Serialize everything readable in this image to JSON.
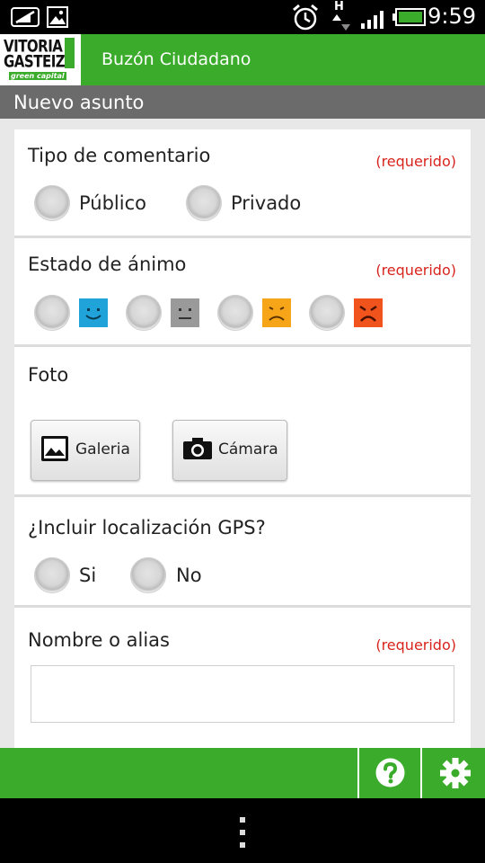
{
  "status_bar": {
    "time": "9:59",
    "network_label": "H"
  },
  "app_bar": {
    "logo_line1": "VITORIA",
    "logo_line2": "GASTEIZ",
    "logo_line3": "green capital",
    "title": "Buzón Ciudadano",
    "accent_color": "#3aab2a"
  },
  "section": {
    "title": "Nuevo asunto"
  },
  "form": {
    "comment_type": {
      "label": "Tipo de comentario",
      "required": "(requerido)",
      "options": [
        "Público",
        "Privado"
      ]
    },
    "mood": {
      "label": "Estado de ánimo",
      "required": "(requerido)",
      "options": [
        {
          "icon": "happy-face-icon",
          "color": "#1fa3d8"
        },
        {
          "icon": "neutral-face-icon",
          "color": "#9a9a9a"
        },
        {
          "icon": "sad-face-icon",
          "color": "#f6a418"
        },
        {
          "icon": "angry-face-icon",
          "color": "#f0541c"
        }
      ]
    },
    "photo": {
      "label": "Foto",
      "gallery_button": "Galeria",
      "camera_button": "Cámara"
    },
    "gps": {
      "label": "¿Incluir localización GPS?",
      "options": [
        "Si",
        "No"
      ]
    },
    "name": {
      "label": "Nombre o alias",
      "required": "(requerido)",
      "value": ""
    }
  },
  "action_bar": {
    "help_icon": "help-icon",
    "settings_icon": "gear-icon"
  },
  "nav_bar": {
    "menu_icon": "menu-dots-icon"
  }
}
